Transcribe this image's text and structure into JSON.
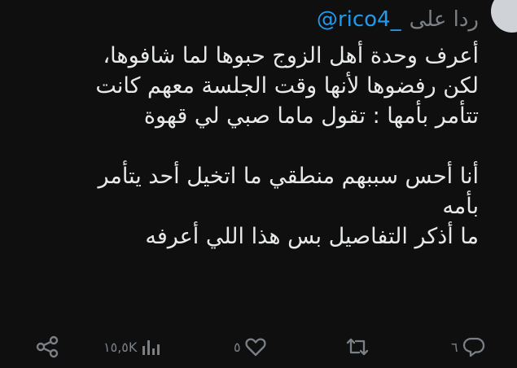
{
  "reply": {
    "prefix": "ردا على",
    "handle": "@rico4_"
  },
  "body": {
    "lines": [
      "أعرف وحدة أهل الزوج حبوها لما شافوها،",
      "لكن رفضوها لأنها وقت الجلسة معهم كانت",
      "تتأمر بأمها : تقول ماما صبي لي قهوة",
      "",
      "أنا أحس سببهم منطقي ما اتخيل أحد يتأمر",
      "بأمه",
      "ما أذكر التفاصيل بس هذا اللي أعرفه"
    ]
  },
  "actions": {
    "replies": "٦",
    "retweets": "",
    "likes": "٥",
    "views": "١٥,٥K"
  },
  "colors": {
    "background": "#0f0f0f",
    "text": "#e7e9ea",
    "muted": "#7b8087",
    "accent": "#1d9bf0"
  },
  "icons": [
    "reply-icon",
    "retweet-icon",
    "like-icon",
    "views-icon",
    "share-icon"
  ]
}
